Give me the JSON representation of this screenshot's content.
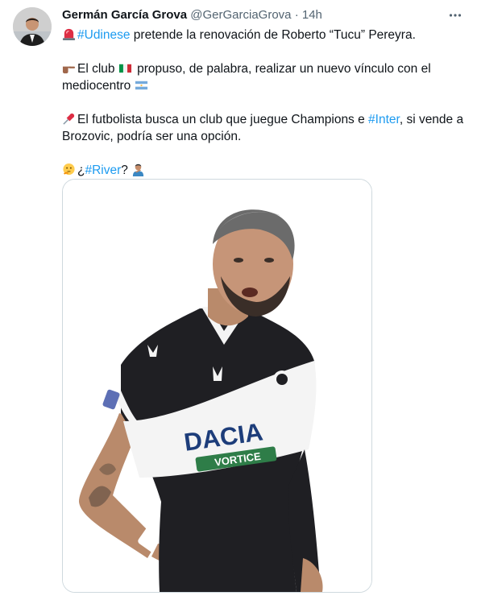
{
  "author": {
    "name": "Germán García Grova",
    "handle": "@GerGarciaGrova",
    "separator": "·",
    "time": "14h"
  },
  "tweet": {
    "line1_text": " pretende la renovación de Roberto “Tucu” Pereyra.",
    "hashtag_udinese": "#Udinese",
    "line2_a": "El club ",
    "line2_b": " propuso, de palabra, realizar un nuevo vínculo con el",
    "line3": "mediocentro ",
    "line4_a": "El futbolista busca un club que juegue Champions e ",
    "hashtag_inter": "#Inter",
    "line4_b": ", si vende a",
    "line5": "Brozovic, podría ser una opción.",
    "line6_a": "¿",
    "hashtag_river": "#River",
    "line6_b": "?"
  },
  "icons": {
    "siren": "siren-icon",
    "pointing_hand": "pointing-hand-icon",
    "italy_flag": "italy-flag-icon",
    "argentina_flag": "argentina-flag-icon",
    "pushpin": "pushpin-icon",
    "thinking_face": "thinking-face-icon",
    "person_gesturing": "person-gesturing-icon",
    "more": "more-dots-icon"
  },
  "media": {
    "jersey_sponsor": "DACIA",
    "jersey_sponsor2": "VORTICE"
  },
  "colors": {
    "link": "#1d9bf0",
    "text": "#0f1419",
    "secondary": "#536471",
    "border": "#cfd9de"
  }
}
